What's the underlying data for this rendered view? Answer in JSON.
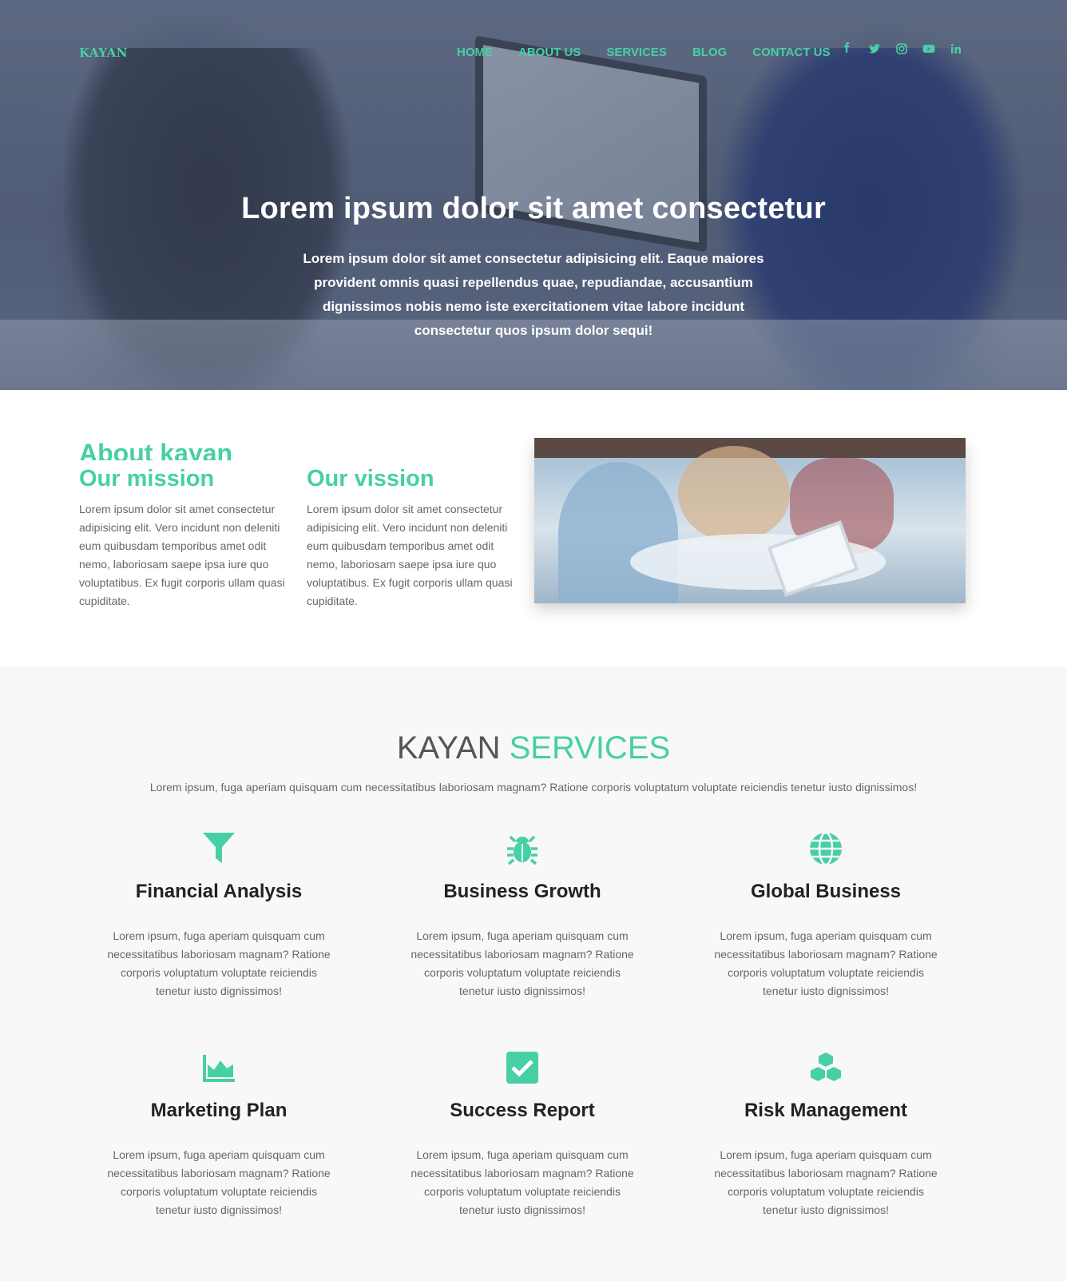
{
  "nav": {
    "logo": "KAYAN",
    "items": [
      "HOME",
      "ABOUT US",
      "SERVICES",
      "BLOG",
      "CONTACT US"
    ],
    "social": [
      "facebook-icon",
      "twitter-icon",
      "instagram-icon",
      "youtube-icon",
      "linkedin-icon"
    ]
  },
  "hero": {
    "title": "Lorem ipsum dolor sit amet consectetur",
    "text": "Lorem ipsum dolor sit amet consectetur adipisicing elit. Eaque maiores provident omnis quasi repellendus quae, repudiandae, accusantium dignissimos nobis nemo iste exercitationem vitae labore incidunt consectetur quos ipsum dolor sequi!"
  },
  "about": {
    "title": "About kayan",
    "mission": {
      "heading": "Our mission",
      "text": "Lorem ipsum dolor sit amet consectetur adipisicing elit. Vero incidunt non deleniti eum quibusdam temporibus amet odit nemo, laboriosam saepe ipsa iure quo voluptatibus. Ex fugit corporis ullam quasi cupiditate."
    },
    "vision": {
      "heading": "Our vission",
      "text": "Lorem ipsum dolor sit amet consectetur adipisicing elit. Vero incidunt non deleniti eum quibusdam temporibus amet odit nemo, laboriosam saepe ipsa iure quo voluptatibus. Ex fugit corporis ullam quasi cupiditate."
    }
  },
  "services": {
    "title_main": "KAYAN",
    "title_accent": "SERVICES",
    "subtitle": "Lorem ipsum, fuga aperiam quisquam cum necessitatibus laboriosam magnam? Ratione corporis voluptatum voluptate reiciendis tenetur iusto dignissimos!",
    "items": [
      {
        "icon": "funnel-icon",
        "title": "Financial Analysis",
        "text": "Lorem ipsum, fuga aperiam quisquam cum necessitatibus laboriosam magnam? Ratione corporis voluptatum voluptate reiciendis tenetur iusto dignissimos!"
      },
      {
        "icon": "bug-icon",
        "title": "Business Growth",
        "text": "Lorem ipsum, fuga aperiam quisquam cum necessitatibus laboriosam magnam? Ratione corporis voluptatum voluptate reiciendis tenetur iusto dignissimos!"
      },
      {
        "icon": "globe-icon",
        "title": "Global Business",
        "text": "Lorem ipsum, fuga aperiam quisquam cum necessitatibus laboriosam magnam? Ratione corporis voluptatum voluptate reiciendis tenetur iusto dignissimos!"
      },
      {
        "icon": "area-chart-icon",
        "title": "Marketing Plan",
        "text": "Lorem ipsum, fuga aperiam quisquam cum necessitatibus laboriosam magnam? Ratione corporis voluptatum voluptate reiciendis tenetur iusto dignissimos!"
      },
      {
        "icon": "check-square-icon",
        "title": "Success Report",
        "text": "Lorem ipsum, fuga aperiam quisquam cum necessitatibus laboriosam magnam? Ratione corporis voluptatum voluptate reiciendis tenetur iusto dignissimos!"
      },
      {
        "icon": "cubes-icon",
        "title": "Risk Management",
        "text": "Lorem ipsum, fuga aperiam quisquam cum necessitatibus laboriosam magnam? Ratione corporis voluptatum voluptate reiciendis tenetur iusto dignissimos!"
      }
    ]
  },
  "colors": {
    "accent": "#47cfa5",
    "services_bg": "#f8f8f8"
  }
}
